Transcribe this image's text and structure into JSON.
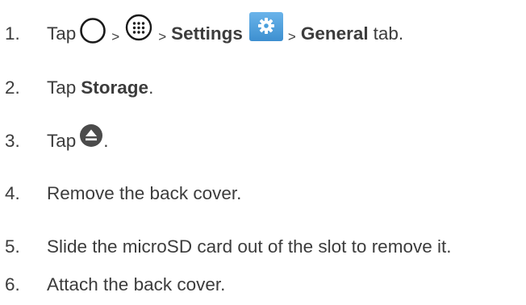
{
  "steps": [
    {
      "number": "1.",
      "tap": "Tap",
      "sep": ">",
      "settings": "Settings",
      "general": "General",
      "tab": "tab.",
      "icons": [
        "home-circle-icon",
        "apps-grid-icon",
        "settings-gear-icon"
      ]
    },
    {
      "number": "2.",
      "tap": "Tap",
      "storage": "Storage",
      "period": "."
    },
    {
      "number": "3.",
      "tap": "Tap",
      "period": ".",
      "icons": [
        "eject-icon"
      ]
    },
    {
      "number": "4.",
      "text": "Remove the back cover."
    },
    {
      "number": "5.",
      "text": "Slide the microSD card out of the slot to remove it."
    },
    {
      "number": "6.",
      "text": "Attach the back cover."
    }
  ],
  "colors": {
    "text": "#3c3c3c",
    "settings_icon_bg": "#4a9fdc",
    "eject_icon_bg": "#4b4b4b"
  }
}
